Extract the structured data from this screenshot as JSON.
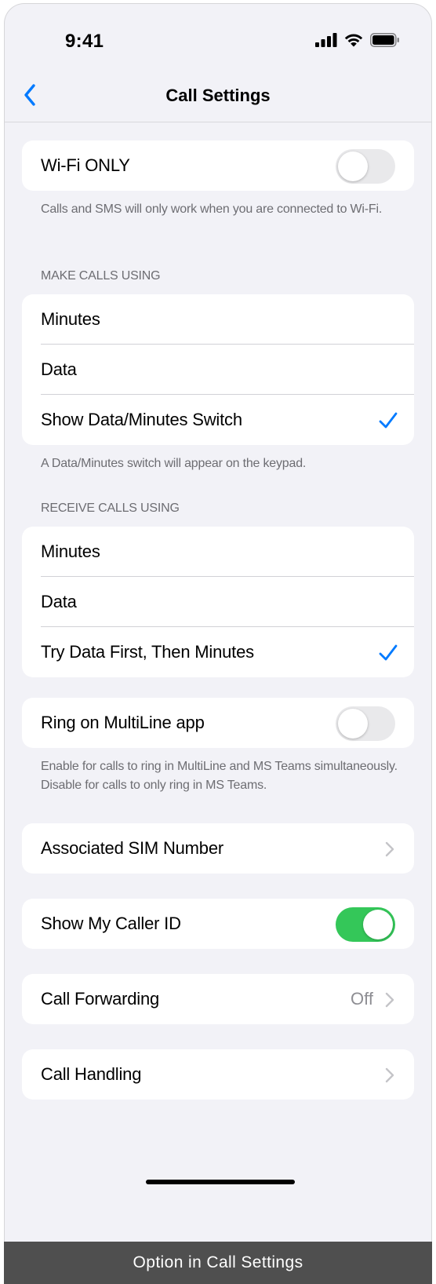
{
  "status_bar": {
    "time": "9:41",
    "icons": [
      "cellular-signal-icon",
      "wifi-icon",
      "battery-icon"
    ]
  },
  "nav": {
    "title": "Call Settings",
    "back_icon": "chevron-left-icon"
  },
  "wifi_only": {
    "label": "Wi-Fi ONLY",
    "enabled": false,
    "footnote": "Calls and SMS will only work when you are connected to Wi-Fi."
  },
  "make_calls": {
    "header": "MAKE CALLS USING",
    "options": [
      "Minutes",
      "Data",
      "Show Data/Minutes Switch"
    ],
    "selected": "Show Data/Minutes Switch",
    "footnote": "A Data/Minutes switch will appear on the keypad."
  },
  "receive_calls": {
    "header": "RECEIVE CALLS USING",
    "options": [
      "Minutes",
      "Data",
      "Try Data First, Then Minutes"
    ],
    "selected": "Try Data First, Then Minutes"
  },
  "ring_multiline": {
    "label": "Ring on MultiLine app",
    "enabled": false,
    "footnote": "Enable for calls to ring in MultiLine and MS Teams simultaneously. Disable for calls to only ring in MS Teams."
  },
  "associated_sim": {
    "label": "Associated SIM Number"
  },
  "caller_id": {
    "label": "Show My Caller ID",
    "enabled": true
  },
  "call_forwarding": {
    "label": "Call Forwarding",
    "value": "Off"
  },
  "call_handling": {
    "label": "Call Handling"
  },
  "colors": {
    "accent": "#007aff",
    "toggle_on": "#34c759",
    "toggle_off": "#e9e9eb",
    "background": "#f2f2f7"
  },
  "caption": "Option in Call Settings"
}
